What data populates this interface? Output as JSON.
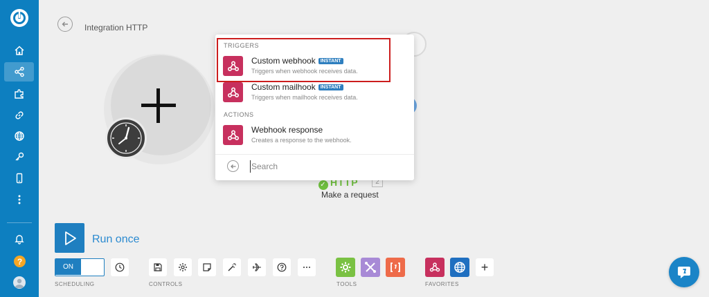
{
  "header": {
    "title": "Integration HTTP"
  },
  "colors": {
    "sidebar": "#0d7fc0",
    "accent": "#1f7fc0",
    "webhook": "#c7305e",
    "highlight": "#cc1d1d",
    "instant_badge": "#2f7fbf"
  },
  "sidebar": {
    "items": [
      {
        "icon": "home-icon"
      },
      {
        "icon": "share-icon",
        "active": true
      },
      {
        "icon": "puzzle-icon"
      },
      {
        "icon": "link-icon"
      },
      {
        "icon": "globe-icon"
      },
      {
        "icon": "key-icon"
      },
      {
        "icon": "mobile-icon"
      },
      {
        "icon": "more-icon"
      }
    ],
    "bottom": [
      {
        "icon": "bell-icon"
      },
      {
        "icon": "help-icon",
        "label": "?"
      },
      {
        "icon": "avatar-icon"
      }
    ]
  },
  "canvas": {
    "http_label": "HTTP",
    "http_count": "2",
    "http_caption": "Make a request"
  },
  "dropdown": {
    "triggers_label": "TRIGGERS",
    "actions_label": "ACTIONS",
    "options": [
      {
        "title": "Custom webhook",
        "badge": "INSTANT",
        "description": "Triggers when webhook receives data.",
        "highlighted": true
      },
      {
        "title": "Custom mailhook",
        "badge": "INSTANT",
        "description": "Triggers when mailhook receives data."
      },
      {
        "title": "Webhook response",
        "badge": "",
        "description": "Creates a response to the webhook."
      }
    ],
    "search_placeholder": "Search"
  },
  "toolbar": {
    "run_label": "Run once",
    "toggle_label": "ON",
    "scheduling_label": "SCHEDULING",
    "controls_label": "CONTROLS",
    "tools_label": "TOOLS",
    "favorites_label": "FAVORITES",
    "controls": [
      "save-icon",
      "gear-icon",
      "note-icon",
      "magic-wand-icon",
      "airplane-icon",
      "help-icon",
      "more-icon"
    ],
    "tools": [
      "tools-gear-icon",
      "flow-control-icon",
      "text-parser-icon"
    ],
    "favorites": [
      "webhook-icon",
      "http-globe-icon"
    ],
    "add_label": "+"
  }
}
